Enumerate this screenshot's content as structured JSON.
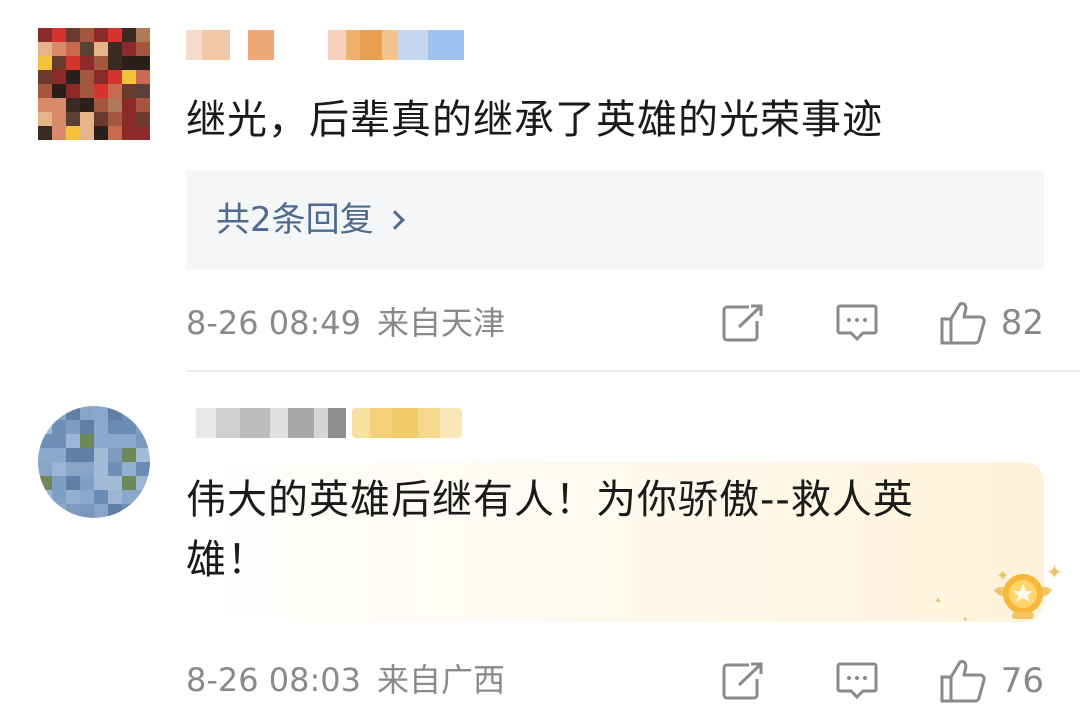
{
  "comments": [
    {
      "text": "继光，后辈真的继承了英雄的光荣事迹",
      "replies_label": "共2条回复",
      "time": "8-26 08:49",
      "location": "来自天津",
      "likes": "82",
      "share_icon": "share-icon",
      "comment_icon": "comment-icon",
      "like_icon": "thumbs-up-icon"
    },
    {
      "text_line1": "伟大的英雄后继有人！为你骄傲--救人英",
      "text_line2": "雄！",
      "time": "8-26 08:03",
      "location": "来自广西",
      "likes": "76",
      "badge_icon": "medal-icon"
    }
  ],
  "colors": {
    "text": "#1a1a1a",
    "meta": "#8a8a8a",
    "link": "#4e6b8f",
    "reply_bg": "#f5f6f8",
    "highlight": "#fff1d6"
  }
}
